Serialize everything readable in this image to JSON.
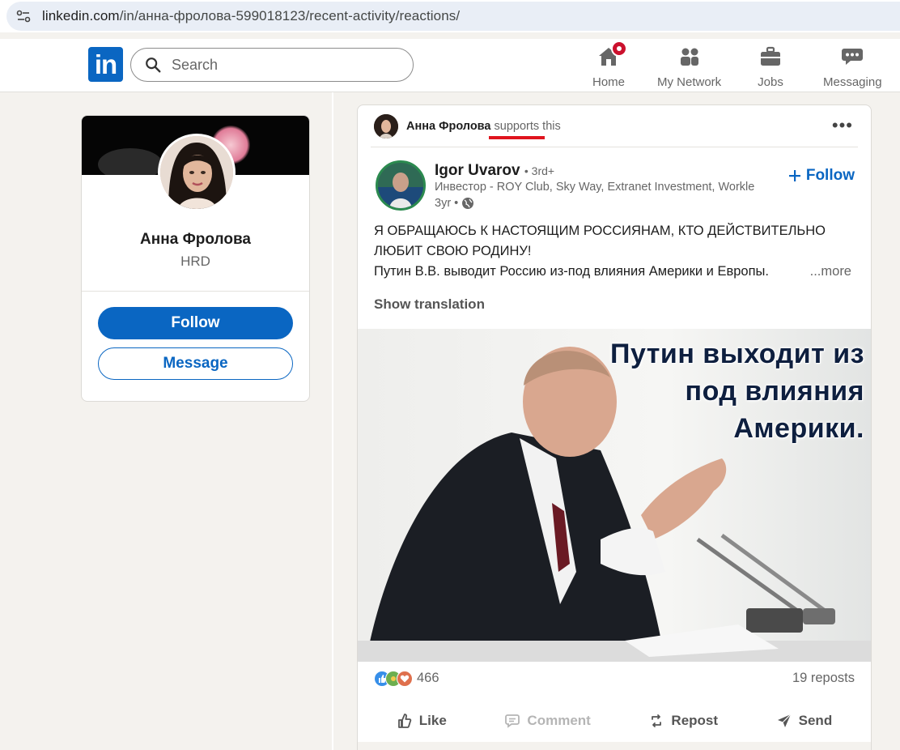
{
  "browser": {
    "url_host": "linkedin.com",
    "url_path": "/in/анна-фролова-599018123/recent-activity/reactions/"
  },
  "nav": {
    "logo_text": "in",
    "search_placeholder": "Search",
    "items": [
      {
        "label": "Home",
        "icon": "home-icon",
        "has_badge": true
      },
      {
        "label": "My Network",
        "icon": "my-network-icon"
      },
      {
        "label": "Jobs",
        "icon": "jobs-icon"
      },
      {
        "label": "Messaging",
        "icon": "messaging-icon"
      }
    ]
  },
  "profile": {
    "name": "Анна Фролова",
    "headline": "HRD",
    "follow_label": "Follow",
    "message_label": "Message"
  },
  "post": {
    "activity": {
      "actor": "Анна Фролова",
      "verb": "supports",
      "object": "this"
    },
    "author": {
      "name": "Igor Uvarov",
      "degree": "• 3rd+",
      "headline": "Инвестор - ROY Club, Sky Way, Extranet Investment, Workle",
      "time": "3yr •"
    },
    "follow_label": "Follow",
    "text_line1": "Я ОБРАЩАЮСЬ К НАСТОЯЩИМ РОССИЯНАМ, КТО ДЕЙСТВИТЕЛЬНО",
    "text_line2": "ЛЮБИТ СВОЮ РОДИНУ!",
    "text_line3": "Путин В.В. выводит Россию из-под влияния Америки и Европы.",
    "see_more": "...more",
    "show_translation": "Show translation",
    "image_caption_lines": [
      "Путин выходит из",
      "под влияния",
      "Америки."
    ],
    "reaction_count": "466",
    "reposts": "19 reposts",
    "actions": {
      "like": "Like",
      "comment": "Comment",
      "repost": "Repost",
      "send": "Send"
    }
  },
  "colors": {
    "linkedin_blue": "#0a66c2",
    "notification_red": "#cb112d",
    "annotation_red": "#e0141e"
  }
}
